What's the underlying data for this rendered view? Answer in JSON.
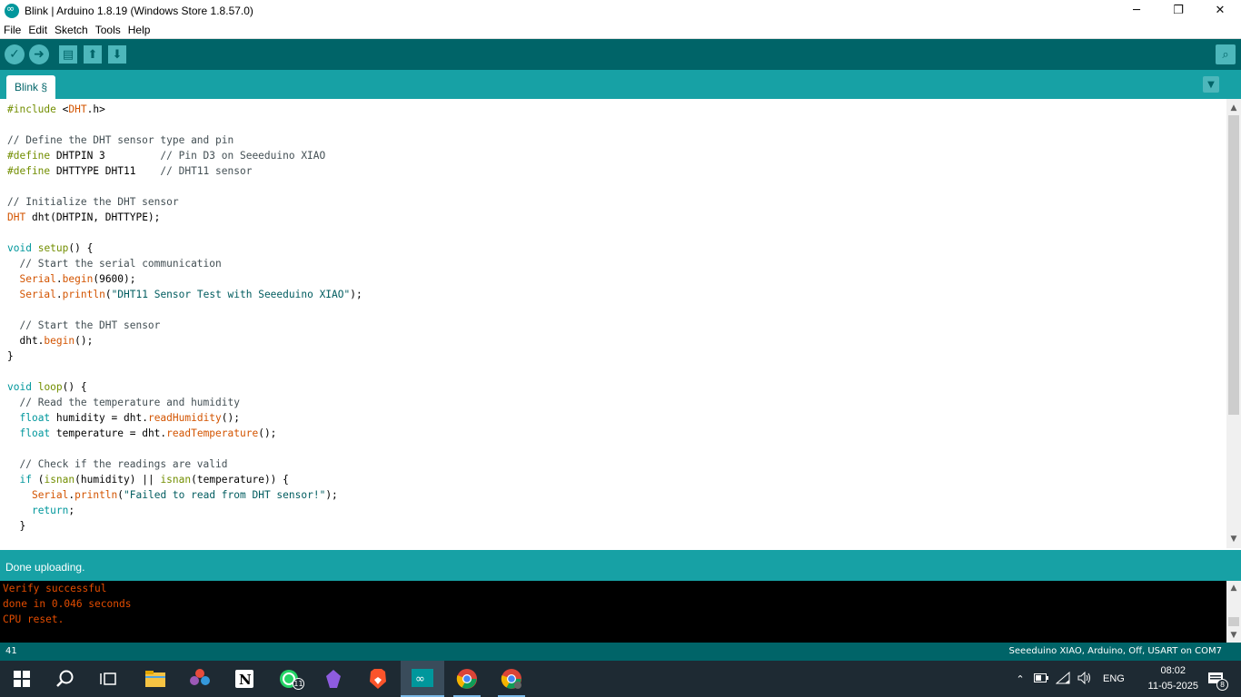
{
  "window": {
    "title": "Blink | Arduino 1.8.19 (Windows Store 1.8.57.0)",
    "minimize": "─",
    "maximize": "❐",
    "close": "✕"
  },
  "menu": [
    "File",
    "Edit",
    "Sketch",
    "Tools",
    "Help"
  ],
  "toolbar": {
    "verify_icon": "✓",
    "upload_icon": "➜",
    "new_icon": "▤",
    "open_icon": "⬆",
    "save_icon": "⬇",
    "serial_icon": "⌕"
  },
  "tabs": {
    "active": "Blink §",
    "menu_icon": "▼"
  },
  "code_lines": [
    "#include <DHT.h>",
    "",
    "// Define the DHT sensor type and pin",
    "#define DHTPIN 3         // Pin D3 on Seeeduino XIAO",
    "#define DHTTYPE DHT11    // DHT11 sensor",
    "",
    "// Initialize the DHT sensor",
    "DHT dht(DHTPIN, DHTTYPE);",
    "",
    "void setup() {",
    "  // Start the serial communication",
    "  Serial.begin(9600);",
    "  Serial.println(\"DHT11 Sensor Test with Seeeduino XIAO\");",
    "",
    "  // Start the DHT sensor",
    "  dht.begin();",
    "}",
    "",
    "void loop() {",
    "  // Read the temperature and humidity",
    "  float humidity = dht.readHumidity();",
    "  float temperature = dht.readTemperature();",
    "",
    "  // Check if the readings are valid",
    "  if (isnan(humidity) || isnan(temperature)) {",
    "    Serial.println(\"Failed to read from DHT sensor!\");",
    "    return;",
    "  }"
  ],
  "status": {
    "message": "Done uploading."
  },
  "console_lines": [
    "Verify successful",
    "done in 0.046 seconds",
    "CPU reset."
  ],
  "bottom": {
    "line_number": "41",
    "board_info": "Seeeduino XIAO, Arduino, Off, USART on COM7"
  },
  "taskbar": {
    "whatsapp_badge": "11",
    "tray_lang": "ENG",
    "time": "08:02",
    "date": "11-05-2025",
    "notification_count": "8"
  }
}
